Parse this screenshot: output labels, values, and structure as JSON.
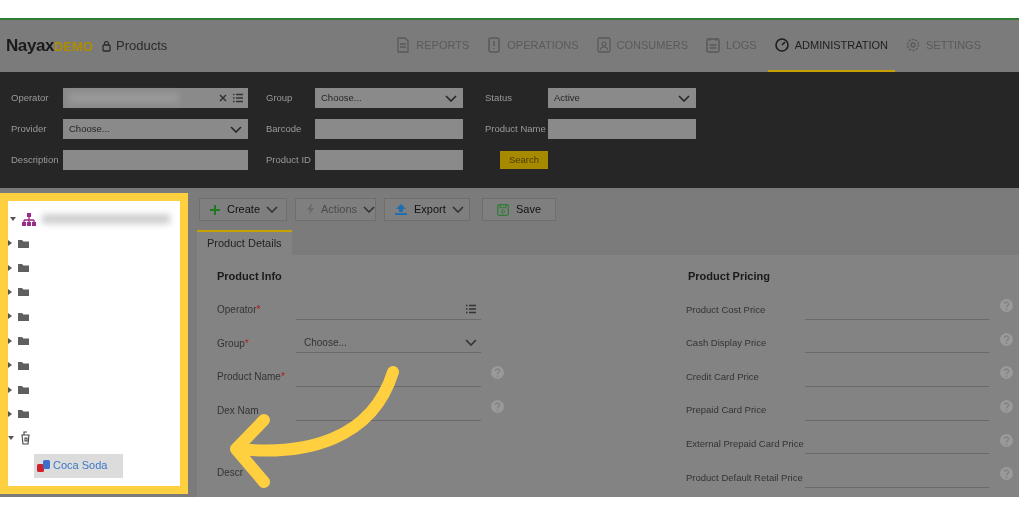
{
  "header": {
    "logo": {
      "brand": "Nayax",
      "suffix": "DEMO"
    },
    "page_title": "Products",
    "nav": [
      {
        "label": "REPORTS",
        "selected": false
      },
      {
        "label": "OPERATIONS",
        "selected": false
      },
      {
        "label": "CONSUMERS",
        "selected": false
      },
      {
        "label": "LOGS",
        "selected": false
      },
      {
        "label": "ADMINISTRATION",
        "selected": true
      },
      {
        "label": "SETTINGS",
        "selected": false
      }
    ]
  },
  "filters": [
    {
      "label": "Operator",
      "kind": "operator"
    },
    {
      "label": "Group",
      "kind": "select",
      "value": "Choose..."
    },
    {
      "label": "Status",
      "kind": "select",
      "value": "Active"
    },
    {
      "label": "Provider",
      "kind": "select",
      "value": "Choose..."
    },
    {
      "label": "Barcode",
      "kind": "text"
    },
    {
      "label": "Product Name",
      "kind": "text"
    },
    {
      "label": "Description",
      "kind": "text"
    },
    {
      "label": "Product ID",
      "kind": "text"
    }
  ],
  "search_button": "Search",
  "tree": {
    "expanded": true,
    "children": [
      {
        "kind": "folder",
        "expanded": false
      },
      {
        "kind": "folder",
        "expanded": false
      },
      {
        "kind": "folder",
        "expanded": false
      },
      {
        "kind": "folder",
        "expanded": false
      },
      {
        "kind": "folder",
        "expanded": false
      },
      {
        "kind": "folder",
        "expanded": false
      },
      {
        "kind": "folder",
        "expanded": false
      },
      {
        "kind": "folder",
        "expanded": false
      },
      {
        "kind": "category",
        "expanded": true,
        "children": [
          {
            "kind": "product",
            "label": "Coca Soda",
            "selected": true
          }
        ]
      }
    ]
  },
  "toolbar": [
    {
      "label": "Create",
      "disabled": false,
      "dropdown": true
    },
    {
      "label": "Actions",
      "disabled": true,
      "dropdown": true
    },
    {
      "label": "Export",
      "disabled": false,
      "dropdown": true
    },
    {
      "label": "Save",
      "disabled": false,
      "dropdown": false
    }
  ],
  "tabs": [
    {
      "label": "Product Details",
      "selected": true
    }
  ],
  "product_info": {
    "title": "Product Info",
    "required_mark": "*",
    "fields": [
      {
        "label": "Operator",
        "required": true,
        "kind": "list"
      },
      {
        "label": "Group",
        "required": true,
        "kind": "select",
        "placeholder": "Choose..."
      },
      {
        "label": "Product Name",
        "required": true,
        "kind": "text",
        "help": true
      },
      {
        "label": "Dex Nam",
        "required": false,
        "kind": "text",
        "help": true
      },
      {
        "label": "Descr",
        "required": false,
        "kind": "bare"
      }
    ]
  },
  "product_pricing": {
    "title": "Product Pricing",
    "fields": [
      {
        "label": "Product Cost Price",
        "help": true
      },
      {
        "label": "Cash Display Price",
        "help": true
      },
      {
        "label": "Credit Card Price",
        "help": true
      },
      {
        "label": "Prepaid Card Price",
        "help": true
      },
      {
        "label": "External Prepaid Card Price",
        "help": true
      },
      {
        "label": "Product Default Retail Price",
        "help": true
      }
    ]
  }
}
